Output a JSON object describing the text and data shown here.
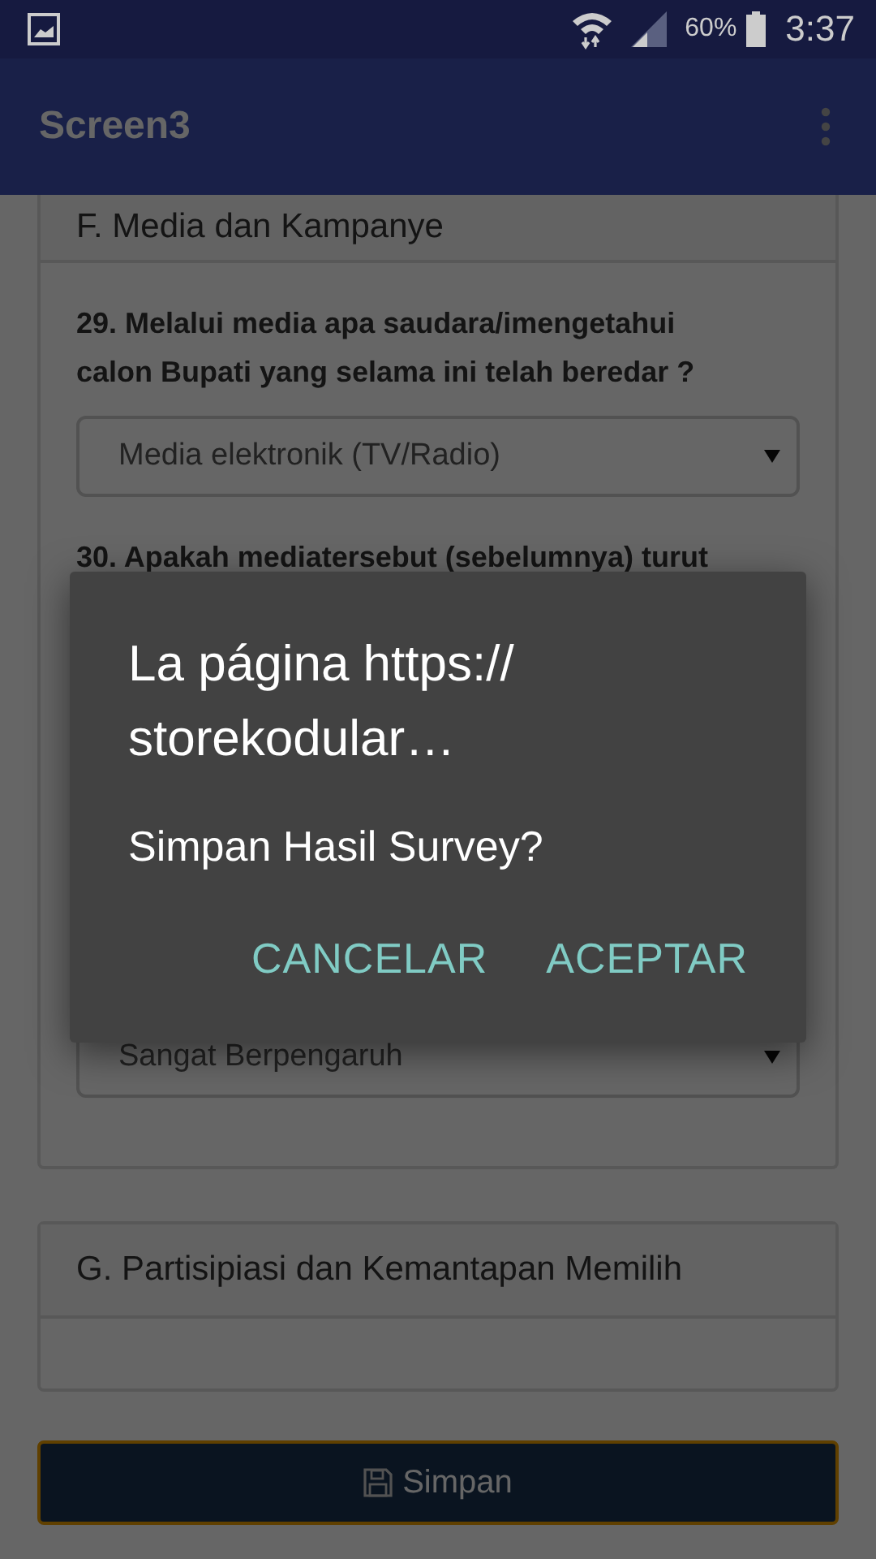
{
  "status_bar": {
    "battery": "60%",
    "time": "3:37"
  },
  "app_bar": {
    "title": "Screen3"
  },
  "sections": [
    {
      "title": "F. Media dan Kampanye",
      "items": [
        {
          "kind": "question",
          "text": "29. Melalui media apa saudara/imengetahui calon Bupati yang selama ini telah beredar ?"
        },
        {
          "kind": "select",
          "value": "Media elektronik (TV/Radio)"
        },
        {
          "kind": "question",
          "text": "30. Apakah mediatersebut (sebelumnya) turut"
        },
        {
          "kind": "select",
          "value": "Sangat Berpengaruh"
        }
      ]
    },
    {
      "title": "G. Partisipiasi dan Kemantapan Memilih"
    }
  ],
  "save_button": {
    "label": "Simpan"
  },
  "dialog": {
    "title": "La página https://\nstorekodular…",
    "message": "Simpan Hasil Survey?",
    "buttons": [
      "CANCELAR",
      "ACEPTAR"
    ]
  }
}
